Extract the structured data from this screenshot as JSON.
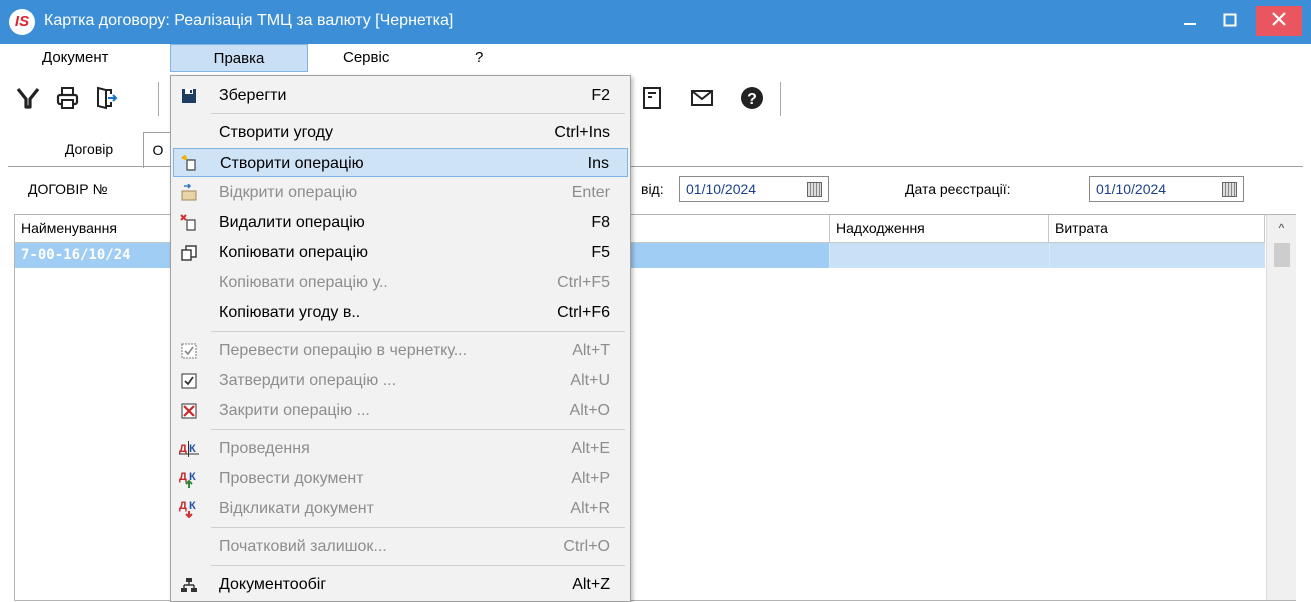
{
  "window": {
    "logo_text": "IS",
    "title": "Картка договору:  Реалізація ТМЦ за валюту [Чернетка]",
    "title_bar_color": "#3c8fd6",
    "close_color": "#e9565f"
  },
  "menubar": {
    "items": [
      "Документ",
      "Правка",
      "Сервіс",
      "?"
    ],
    "active": "Правка"
  },
  "toolbar": {
    "icons": [
      "filter-icon",
      "print-icon",
      "exit-icon",
      "document-icon",
      "envelope-icon",
      "help-icon"
    ]
  },
  "tabs": [
    {
      "label": "Договір"
    },
    {
      "label": "О"
    }
  ],
  "contract": {
    "number_label": "ДОГОВІР №",
    "from_label": "від:",
    "from_date": "01/10/2024",
    "reg_label": "Дата реєстрації:",
    "reg_date": "01/10/2024"
  },
  "grid": {
    "columns": [
      "Найменування",
      "Надходження",
      "Витрата"
    ],
    "rows": [
      {
        "name": "7-00-16/10/24",
        "income": "",
        "expense": ""
      }
    ],
    "selected_row_color": "#9fcdf3"
  },
  "edit_menu": {
    "items": [
      {
        "label": "Зберегти",
        "key": "F2",
        "icon": "save-icon",
        "disabled": false
      },
      {
        "label": "Створити угоду",
        "key": "Ctrl+Ins",
        "icon": "",
        "disabled": false
      },
      {
        "label": "Створити операцію",
        "key": "Ins",
        "icon": "new-operation-icon",
        "disabled": false,
        "highlighted": true
      },
      {
        "label": "Відкрити операцію",
        "key": "Enter",
        "icon": "open-operation-icon",
        "disabled": true
      },
      {
        "label": "Видалити операцію",
        "key": "F8",
        "icon": "delete-operation-icon",
        "disabled": false
      },
      {
        "label": "Копіювати операцію",
        "key": "F5",
        "icon": "copy-icon",
        "disabled": false
      },
      {
        "label": "Копіювати операцію у..",
        "key": "Ctrl+F5",
        "icon": "",
        "disabled": true
      },
      {
        "label": "Копіювати угоду в..",
        "key": "Ctrl+F6",
        "icon": "",
        "disabled": false
      },
      {
        "label": "Перевести операцію в чернетку...",
        "key": "Alt+T",
        "icon": "draft-check-icon",
        "disabled": true
      },
      {
        "label": "Затвердити операцію ...",
        "key": "Alt+U",
        "icon": "approve-check-icon",
        "disabled": true
      },
      {
        "label": "Закрити операцію ...",
        "key": "Alt+O",
        "icon": "close-x-icon",
        "disabled": true
      },
      {
        "label": "Проведення",
        "key": "Alt+E",
        "icon": "posting-dk-icon",
        "disabled": true
      },
      {
        "label": "Провести документ",
        "key": "Alt+P",
        "icon": "post-document-icon",
        "disabled": true
      },
      {
        "label": "Відкликати документ",
        "key": "Alt+R",
        "icon": "recall-document-icon",
        "disabled": true
      },
      {
        "label": "Початковий залишок...",
        "key": "Ctrl+O",
        "icon": "",
        "disabled": true
      },
      {
        "label": "Документообіг",
        "key": "Alt+Z",
        "icon": "workflow-icon",
        "disabled": false
      }
    ]
  }
}
